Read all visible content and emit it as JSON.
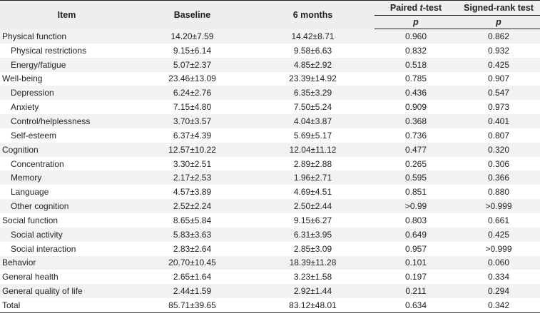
{
  "header": {
    "item": "Item",
    "baseline": "Baseline",
    "six_months": "6 months",
    "paired_prefix": "Paired ",
    "paired_t": "t",
    "paired_suffix": "-test",
    "signed_rank": "Signed-rank test",
    "p1": "p",
    "p2": "p"
  },
  "rows": [
    {
      "item": "Physical function",
      "baseline": "14.20±7.59",
      "six_months": "14.42±8.71",
      "paired_p": "0.960",
      "signed_p": "0.862",
      "sub": false,
      "shade": true
    },
    {
      "item": "Physical restrictions",
      "baseline": "9.15±6.14",
      "six_months": "9.58±6.63",
      "paired_p": "0.832",
      "signed_p": "0.932",
      "sub": true,
      "shade": false
    },
    {
      "item": "Energy/fatigue",
      "baseline": "5.07±2.37",
      "six_months": "4.85±2.92",
      "paired_p": "0.518",
      "signed_p": "0.425",
      "sub": true,
      "shade": true
    },
    {
      "item": "Well-being",
      "baseline": "23.46±13.09",
      "six_months": "23.39±14.92",
      "paired_p": "0.785",
      "signed_p": "0.907",
      "sub": false,
      "shade": false
    },
    {
      "item": "Depression",
      "baseline": "6.24±2.76",
      "six_months": "6.35±3.29",
      "paired_p": "0.436",
      "signed_p": "0.547",
      "sub": true,
      "shade": true
    },
    {
      "item": "Anxiety",
      "baseline": "7.15±4.80",
      "six_months": "7.50±5.24",
      "paired_p": "0.909",
      "signed_p": "0.973",
      "sub": true,
      "shade": false
    },
    {
      "item": "Control/helplessness",
      "baseline": "3.70±3.57",
      "six_months": "4.04±3.87",
      "paired_p": "0.368",
      "signed_p": "0.401",
      "sub": true,
      "shade": true
    },
    {
      "item": "Self-esteem",
      "baseline": "6.37±4.39",
      "six_months": "5.69±5.17",
      "paired_p": "0.736",
      "signed_p": "0.807",
      "sub": true,
      "shade": false
    },
    {
      "item": "Cognition",
      "baseline": "12.57±10.22",
      "six_months": "12.04±11.12",
      "paired_p": "0.477",
      "signed_p": "0.320",
      "sub": false,
      "shade": true
    },
    {
      "item": "Concentration",
      "baseline": "3.30±2.51",
      "six_months": "2.89±2.88",
      "paired_p": "0.265",
      "signed_p": "0.306",
      "sub": true,
      "shade": false
    },
    {
      "item": "Memory",
      "baseline": "2.17±2.53",
      "six_months": "1.96±2.71",
      "paired_p": "0.595",
      "signed_p": "0.366",
      "sub": true,
      "shade": true
    },
    {
      "item": "Language",
      "baseline": "4.57±3.89",
      "six_months": "4.69±4.51",
      "paired_p": "0.851",
      "signed_p": "0.880",
      "sub": true,
      "shade": false
    },
    {
      "item": "Other cognition",
      "baseline": "2.52±2.24",
      "six_months": "2.50±2.44",
      "paired_p": ">0.99",
      "signed_p": ">0.999",
      "sub": true,
      "shade": true
    },
    {
      "item": "Social function",
      "baseline": "8.65±5.84",
      "six_months": "9.15±6.27",
      "paired_p": "0.803",
      "signed_p": "0.661",
      "sub": false,
      "shade": false
    },
    {
      "item": "Social activity",
      "baseline": "5.83±3.63",
      "six_months": "6.31±3.95",
      "paired_p": "0.649",
      "signed_p": "0.425",
      "sub": true,
      "shade": true
    },
    {
      "item": "Social interaction",
      "baseline": "2.83±2.64",
      "six_months": "2.85±3.09",
      "paired_p": "0.957",
      "signed_p": ">0.999",
      "sub": true,
      "shade": false
    },
    {
      "item": "Behavior",
      "baseline": "20.70±10.45",
      "six_months": "18.39±11.28",
      "paired_p": "0.101",
      "signed_p": "0.060",
      "sub": false,
      "shade": true
    },
    {
      "item": "General health",
      "baseline": "2.65±1.64",
      "six_months": "3.23±1.58",
      "paired_p": "0.197",
      "signed_p": "0.334",
      "sub": false,
      "shade": false
    },
    {
      "item": "General quality of life",
      "baseline": "2.44±1.59",
      "six_months": "2.92±1.44",
      "paired_p": "0.211",
      "signed_p": "0.294",
      "sub": false,
      "shade": true
    },
    {
      "item": "Total",
      "baseline": "85.71±39.65",
      "six_months": "83.12±48.01",
      "paired_p": "0.634",
      "signed_p": "0.342",
      "sub": false,
      "shade": false
    }
  ]
}
